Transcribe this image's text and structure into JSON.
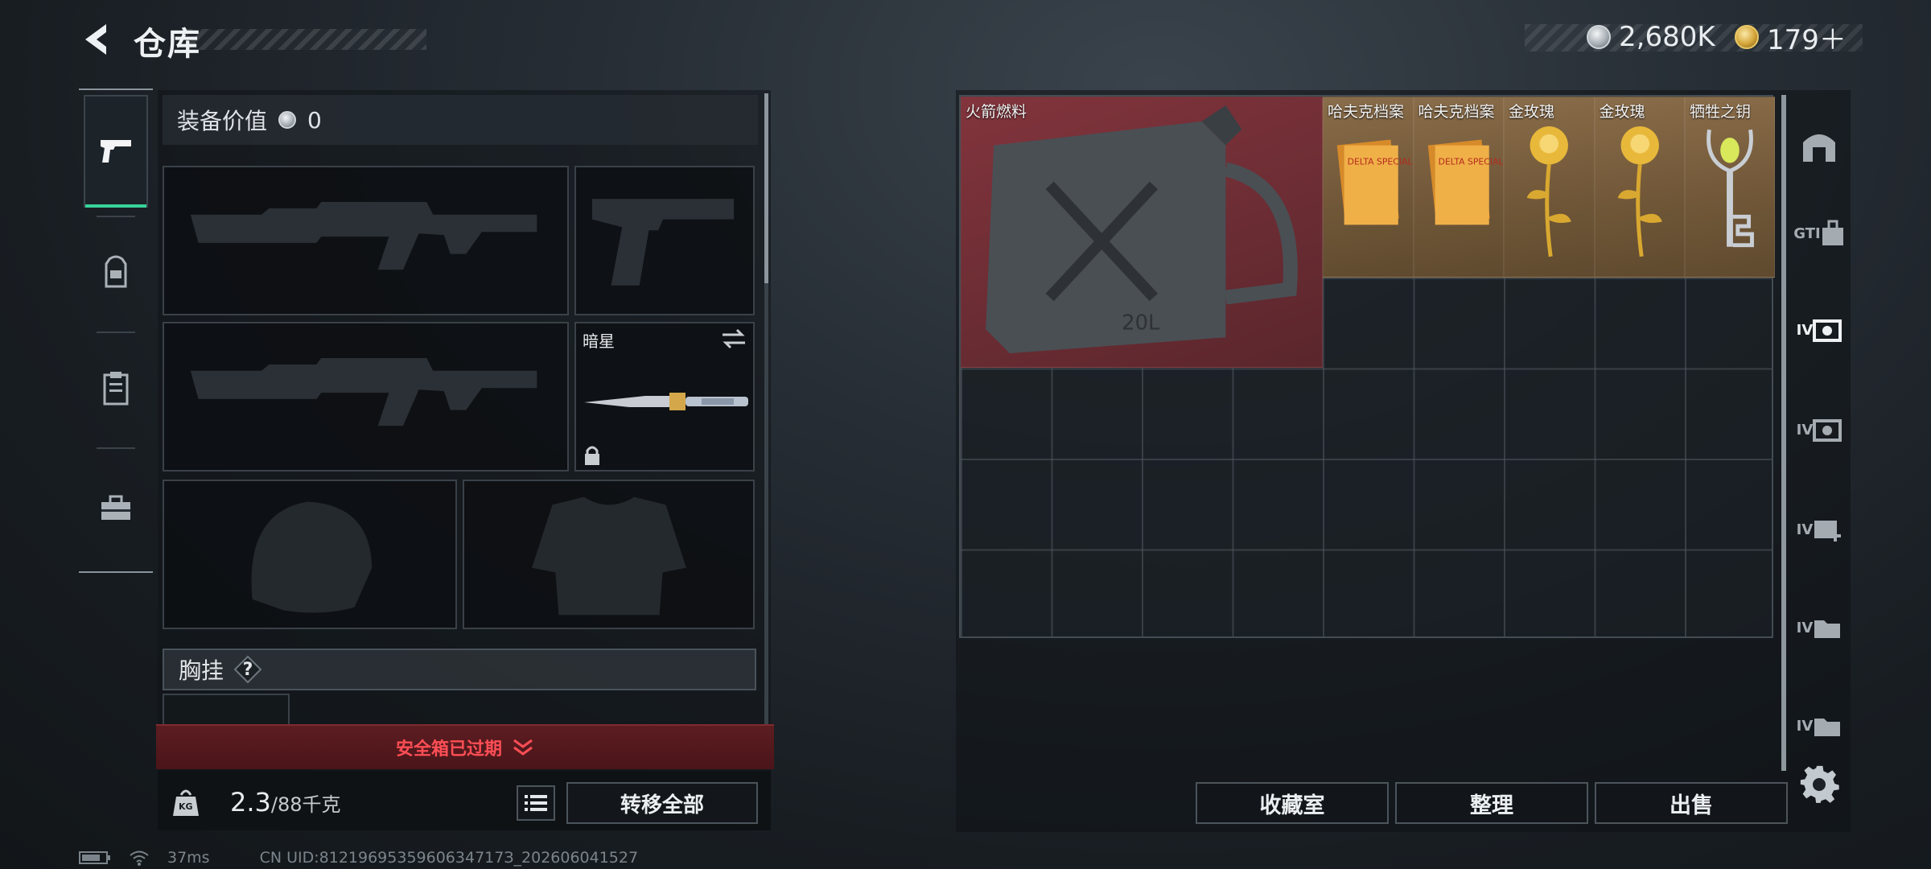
{
  "header": {
    "title": "仓库",
    "currencies": [
      {
        "icon": "silver-coin-icon",
        "value": "2,680K"
      },
      {
        "icon": "gold-coin-icon",
        "value": "179＋"
      }
    ]
  },
  "nav": {
    "items": [
      {
        "name": "weapons",
        "icon": "pistol-icon",
        "active": true
      },
      {
        "name": "backpack",
        "icon": "backpack-icon",
        "active": false
      },
      {
        "name": "chest-rig",
        "icon": "clipboard-icon",
        "active": false
      },
      {
        "name": "toolbox",
        "icon": "toolbox-icon",
        "active": false
      }
    ]
  },
  "loadout": {
    "value_label": "装备价值",
    "value": "0",
    "melee_label": "暗星",
    "chest_label": "胸挂",
    "chest_help": "?",
    "expired_text": "安全箱已过期",
    "weight_current": "2.3",
    "weight_max": "/88千克",
    "weight_icon_text": "KG",
    "transfer_all_label": "转移全部"
  },
  "storage": {
    "items": [
      {
        "name": "火箭燃料",
        "color": "red",
        "icon": "jerrycan-icon"
      },
      {
        "name": "哈夫克档案",
        "color": "gold",
        "icon": "documents-icon"
      },
      {
        "name": "哈夫克档案",
        "color": "gold",
        "icon": "documents-icon"
      },
      {
        "name": "金玫瑰",
        "color": "gold",
        "icon": "rose-icon"
      },
      {
        "name": "金玫瑰",
        "color": "gold",
        "icon": "rose-icon"
      },
      {
        "name": "牺牲之钥",
        "color": "gold",
        "icon": "key-icon"
      }
    ],
    "jerrycan_text": "20L",
    "document_text": "DELTA SPECIAL FORCES"
  },
  "side_tabs": [
    {
      "label": "",
      "icon": "locker-icon"
    },
    {
      "label": "GTI",
      "icon": "storage-case-icon"
    },
    {
      "label": "IV",
      "icon": "ammo-box-icon"
    },
    {
      "label": "IV",
      "icon": "ammo-box-icon"
    },
    {
      "label": "IV",
      "icon": "medical-case-icon"
    },
    {
      "label": "IV",
      "icon": "folder-case-icon"
    },
    {
      "label": "IV",
      "icon": "folder-case-icon"
    }
  ],
  "actions": {
    "collection": "收藏室",
    "sort": "整理",
    "sell": "出售"
  },
  "status": {
    "ping": "37ms",
    "uid": "CN UID:8121969535960634717З_202606041527"
  },
  "colors": {
    "accent_green": "#38d39a",
    "alert_red": "#ff4e55",
    "rarity_red": "#82343c",
    "rarity_gold": "#8a6d4a"
  }
}
